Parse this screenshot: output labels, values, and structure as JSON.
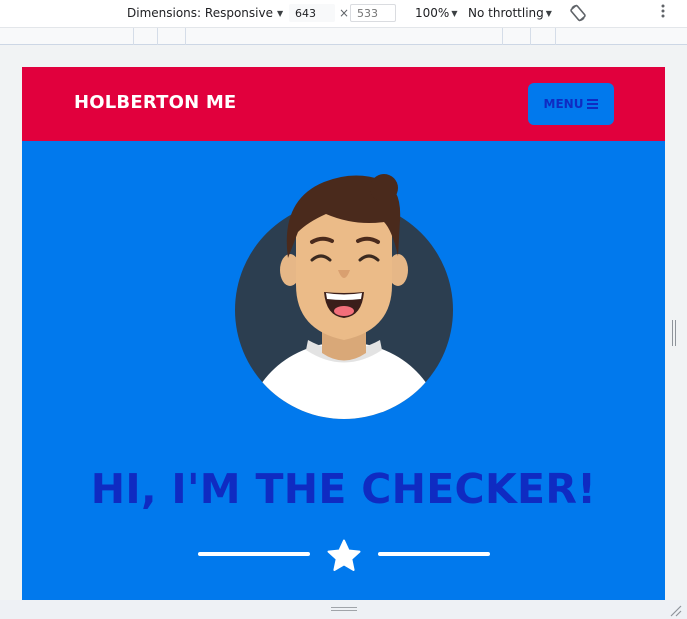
{
  "devtools": {
    "dimensions_label": "Dimensions: Responsive",
    "width_value": "643",
    "times_sign": "×",
    "height_placeholder": "533",
    "zoom": "100%",
    "throttling": "No throttling"
  },
  "site": {
    "brand": "HOLBERTON ME",
    "menu_label": "MENU",
    "headline": "HI, I'M THE CHECKER!"
  },
  "colors": {
    "header_red": "#e1003d",
    "hero_blue": "#0179ed",
    "headline_blue": "#0f2bc2",
    "avatar_bg": "#2c3e50"
  },
  "icons": {
    "dropdown": "caret-down-icon",
    "rotate": "rotate-device-icon",
    "more": "more-vertical-icon",
    "menu": "hamburger-icon",
    "divider": "star-icon"
  }
}
